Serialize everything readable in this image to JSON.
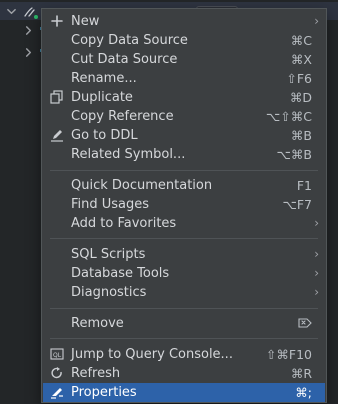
{
  "context_menu": {
    "items": [
      {
        "label": "New",
        "shortcut": "",
        "submenu": true,
        "icon": "plus-icon"
      },
      {
        "label": "Copy Data Source",
        "shortcut": "⌘C",
        "submenu": false,
        "icon": ""
      },
      {
        "label": "Cut Data Source",
        "shortcut": "⌘X",
        "submenu": false,
        "icon": ""
      },
      {
        "label": "Rename...",
        "shortcut": "⇧F6",
        "submenu": false,
        "icon": ""
      },
      {
        "label": "Duplicate",
        "shortcut": "⌘D",
        "submenu": false,
        "icon": "duplicate-icon"
      },
      {
        "label": "Copy Reference",
        "shortcut": "⌥⇧⌘C",
        "submenu": false,
        "icon": ""
      },
      {
        "label": "Go to DDL",
        "shortcut": "⌘B",
        "submenu": false,
        "icon": "pencil-icon"
      },
      {
        "label": "Related Symbol...",
        "shortcut": "⌥⌘B",
        "submenu": false,
        "icon": ""
      },
      {
        "label": "Quick Documentation",
        "shortcut": "F1",
        "submenu": false,
        "icon": ""
      },
      {
        "label": "Find Usages",
        "shortcut": "⌥F7",
        "submenu": false,
        "icon": ""
      },
      {
        "label": "Add to Favorites",
        "shortcut": "",
        "submenu": true,
        "icon": ""
      },
      {
        "label": "SQL Scripts",
        "shortcut": "",
        "submenu": true,
        "icon": ""
      },
      {
        "label": "Database Tools",
        "shortcut": "",
        "submenu": true,
        "icon": ""
      },
      {
        "label": "Diagnostics",
        "shortcut": "",
        "submenu": true,
        "icon": ""
      },
      {
        "label": "Remove",
        "shortcut": "⌦",
        "submenu": false,
        "icon": ""
      },
      {
        "label": "Jump to Query Console...",
        "shortcut": "⇧⌘F10",
        "submenu": false,
        "icon": "console-icon"
      },
      {
        "label": "Refresh",
        "shortcut": "⌘R",
        "submenu": false,
        "icon": "refresh-icon"
      },
      {
        "label": "Properties",
        "shortcut": "⌘;",
        "submenu": false,
        "icon": "properties-icon",
        "selected": true
      }
    ]
  },
  "colors": {
    "menu_background": "#3C3F41",
    "selection": "#2D62A9",
    "text": "#D6D8DB",
    "shortcut_text": "#B8BDC2"
  }
}
